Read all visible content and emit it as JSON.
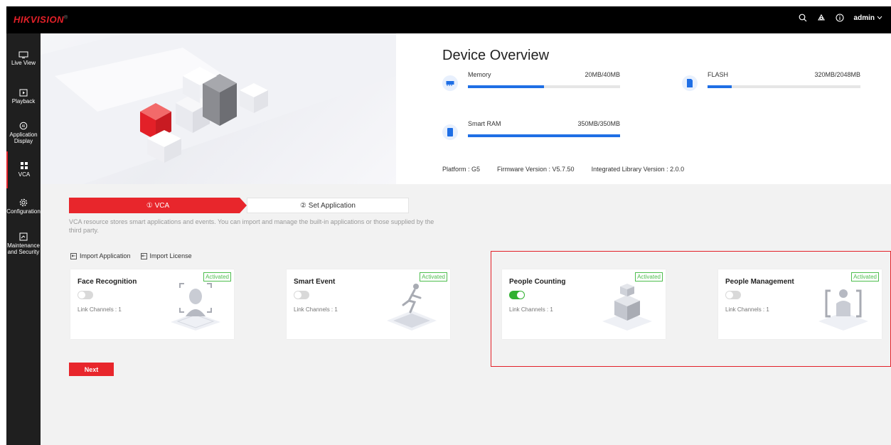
{
  "topbar": {
    "logo": "HIKVISION",
    "logo_mark": "®",
    "user": "admin"
  },
  "sidebar": {
    "items": [
      {
        "label": "Live View"
      },
      {
        "label": "Playback"
      },
      {
        "label": "Application Display"
      },
      {
        "label": "VCA"
      },
      {
        "label": "Configuration"
      },
      {
        "label": "Maintenance and Security"
      }
    ]
  },
  "overview": {
    "title": "Device Overview",
    "memory": {
      "label": "Memory",
      "value": "20MB/40MB",
      "fraction": 0.5
    },
    "flash": {
      "label": "FLASH",
      "value": "320MB/2048MB",
      "fraction": 0.16
    },
    "smart_ram": {
      "label": "Smart RAM",
      "value": "350MB/350MB",
      "fraction": 1.0
    },
    "platform": "Platform : G5",
    "firmware": "Firmware Version : V5.7.50",
    "library": "Integrated Library Version : 2.0.0"
  },
  "steps": {
    "step1": "① VCA",
    "step2": "② Set Application"
  },
  "description": "VCA resource stores smart applications and events. You can import and manage the built-in applications or those supplied by the third party.",
  "actions": {
    "import_application": "Import Application",
    "import_license": "Import License"
  },
  "cards": [
    {
      "title": "Face Recognition",
      "badge": "Activated",
      "enabled": false,
      "link_channels": "Link Channels : 1"
    },
    {
      "title": "Smart Event",
      "badge": "Activated",
      "enabled": false,
      "link_channels": "Link Channels : 1"
    },
    {
      "title": "People Counting",
      "badge": "Activated",
      "enabled": true,
      "link_channels": "Link Channels : 1"
    },
    {
      "title": "People Management",
      "badge": "Activated",
      "enabled": false,
      "link_channels": "Link Channels : 1"
    }
  ],
  "next_button": "Next",
  "colors": {
    "accent": "#e8262c",
    "progress": "#1f6fe5",
    "activated": "#4cbd4c",
    "toggle_on": "#31b131"
  }
}
